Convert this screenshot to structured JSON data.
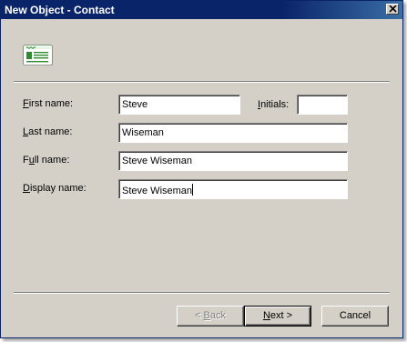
{
  "window": {
    "title": "New Object - Contact"
  },
  "icons": {
    "contact": "contact-card-icon",
    "close": "close-icon"
  },
  "form": {
    "first_name": {
      "label_mnemonic": "F",
      "label_rest": "irst name:",
      "value": "Steve"
    },
    "initials": {
      "label_mnemonic": "I",
      "label_rest": "nitials:",
      "value": ""
    },
    "last_name": {
      "label_mnemonic": "L",
      "label_rest": "ast name:",
      "value": "Wiseman"
    },
    "full_name": {
      "label_pre": "F",
      "label_mnemonic": "u",
      "label_rest": "ll name:",
      "value": "Steve Wiseman"
    },
    "display_name": {
      "label_mnemonic": "D",
      "label_rest": "isplay name:",
      "value": "Steve Wiseman"
    }
  },
  "buttons": {
    "back": {
      "prefix": "< ",
      "mnemonic": "B",
      "rest": "ack",
      "enabled": false
    },
    "next": {
      "mnemonic": "N",
      "rest": "ext >",
      "enabled": true
    },
    "cancel": {
      "label": "Cancel",
      "enabled": true
    }
  },
  "colors": {
    "titlebar": "#0a246a",
    "dialog_bg": "#d4d0c8",
    "icon_green": "#2e8b2e"
  }
}
